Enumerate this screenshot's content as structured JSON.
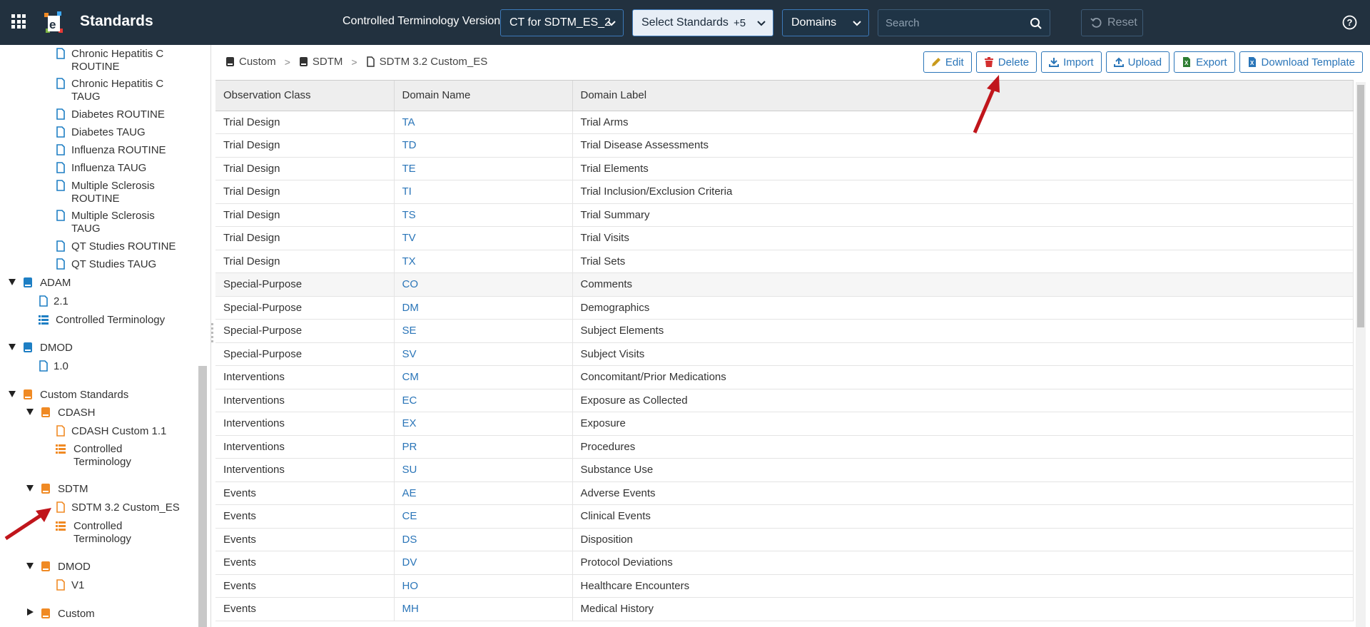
{
  "topbar": {
    "app_title": "Standards",
    "ct_label": "Controlled Terminology Version",
    "ct_select": "CT for SDTM_ES_2",
    "standards_select": "Select Standards",
    "standards_more": "+5",
    "domains_select": "Domains",
    "search_placeholder": "Search",
    "reset_label": "Reset"
  },
  "sidebar": {
    "items": [
      {
        "label": "Chronic Hepatitis C ROUTINE"
      },
      {
        "label": "Chronic Hepatitis C TAUG"
      },
      {
        "label": "Diabetes ROUTINE"
      },
      {
        "label": "Diabetes TAUG"
      },
      {
        "label": "Influenza ROUTINE"
      },
      {
        "label": "Influenza TAUG"
      },
      {
        "label": "Multiple Sclerosis ROUTINE"
      },
      {
        "label": "Multiple Sclerosis TAUG"
      },
      {
        "label": "QT Studies ROUTINE"
      },
      {
        "label": "QT Studies TAUG"
      },
      {
        "label": "ADAM"
      },
      {
        "label": "2.1"
      },
      {
        "label": "Controlled Terminology"
      },
      {
        "label": "DMOD"
      },
      {
        "label": "1.0"
      },
      {
        "label": "Custom Standards"
      },
      {
        "label": "CDASH"
      },
      {
        "label": "CDASH Custom 1.1"
      },
      {
        "label": "Controlled Terminology"
      },
      {
        "label": "SDTM"
      },
      {
        "label": "SDTM 3.2 Custom_ES"
      },
      {
        "label": "Controlled Terminology"
      },
      {
        "label": "DMOD"
      },
      {
        "label": "V1"
      },
      {
        "label": "Custom"
      }
    ]
  },
  "breadcrumb": [
    "Custom",
    "SDTM",
    "SDTM 3.2 Custom_ES"
  ],
  "actions": {
    "edit": "Edit",
    "delete": "Delete",
    "import": "Import",
    "upload": "Upload",
    "export": "Export",
    "download_template": "Download Template"
  },
  "table": {
    "headers": [
      "Observation Class",
      "Domain Name",
      "Domain Label"
    ],
    "rows": [
      [
        "Trial Design",
        "TA",
        "Trial Arms"
      ],
      [
        "Trial Design",
        "TD",
        "Trial Disease Assessments"
      ],
      [
        "Trial Design",
        "TE",
        "Trial Elements"
      ],
      [
        "Trial Design",
        "TI",
        "Trial Inclusion/Exclusion Criteria"
      ],
      [
        "Trial Design",
        "TS",
        "Trial Summary"
      ],
      [
        "Trial Design",
        "TV",
        "Trial Visits"
      ],
      [
        "Trial Design",
        "TX",
        "Trial Sets"
      ],
      [
        "Special-Purpose",
        "CO",
        "Comments"
      ],
      [
        "Special-Purpose",
        "DM",
        "Demographics"
      ],
      [
        "Special-Purpose",
        "SE",
        "Subject Elements"
      ],
      [
        "Special-Purpose",
        "SV",
        "Subject Visits"
      ],
      [
        "Interventions",
        "CM",
        "Concomitant/Prior Medications"
      ],
      [
        "Interventions",
        "EC",
        "Exposure as Collected"
      ],
      [
        "Interventions",
        "EX",
        "Exposure"
      ],
      [
        "Interventions",
        "PR",
        "Procedures"
      ],
      [
        "Interventions",
        "SU",
        "Substance Use"
      ],
      [
        "Events",
        "AE",
        "Adverse Events"
      ],
      [
        "Events",
        "CE",
        "Clinical Events"
      ],
      [
        "Events",
        "DS",
        "Disposition"
      ],
      [
        "Events",
        "DV",
        "Protocol Deviations"
      ],
      [
        "Events",
        "HO",
        "Healthcare Encounters"
      ],
      [
        "Events",
        "MH",
        "Medical History"
      ]
    ]
  },
  "colors": {
    "topbar": "#22313f",
    "accent": "#2a75b8",
    "standard_icon": "#1e7fc4",
    "custom_icon": "#f08a24",
    "annotation_arrow": "#c0151b"
  }
}
